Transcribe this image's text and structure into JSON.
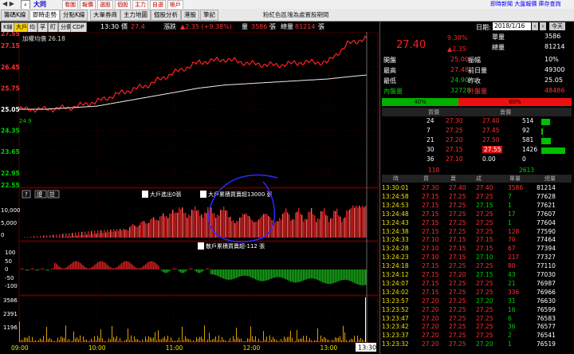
{
  "app": {
    "toolbar_buttons": [
      "看圖",
      "報價",
      "選股",
      "個股",
      "主力",
      "自選",
      "帳戶"
    ],
    "toolbar_right": [
      "即時新聞",
      "大盤報價",
      "庫存查詢"
    ]
  },
  "tabs": [
    "籌碼K線",
    "即時走勢",
    "分點K線",
    "大單券商",
    "主力地圖",
    "個股分析",
    "港股",
    "筆記"
  ],
  "active_tab": "即時走勢",
  "header": {
    "title_text": "粉紅色區塊為處置股期間",
    "search_icon": "search-icon",
    "stock_name": "大同"
  },
  "chart_toolbar": {
    "buttons": [
      "K線",
      "大戶",
      "均",
      "孚",
      "盯",
      "分價",
      "CDP"
    ],
    "selected": "大戶",
    "time": "13:30",
    "price_label": "價",
    "price": "27.4",
    "change_label": "漲跌",
    "change": "▲2.35 (+9.38%)",
    "vol_label": "量",
    "vol": "3586",
    "vol_unit": "張",
    "total_label": "總量",
    "total": "81214",
    "total_unit": "張"
  },
  "price_panel": {
    "legend": "加權均價 26.18",
    "y_ticks": [
      "27.55",
      "27.15",
      "26.45",
      "25.75",
      "25.05",
      "24.35",
      "23.65",
      "22.95",
      "22.55"
    ],
    "low_label": "24.9"
  },
  "big_panel": {
    "help": "?",
    "tabs": [
      "證",
      "註"
    ],
    "legend1": "大戶進出0張",
    "legend2": "大戶累積買賣超13000 張",
    "y_ticks": [
      "10,000",
      "5,000",
      "0"
    ]
  },
  "diff_panel": {
    "legend": "散戶累積買賣超-112 張",
    "y_ticks": [
      "100",
      "50",
      "0",
      "-50",
      "-100"
    ]
  },
  "vol_panel": {
    "y_ticks": [
      "3586",
      "2391",
      "1196"
    ]
  },
  "x_ticks": [
    "09:00",
    "10:00",
    "11:00",
    "12:00",
    "13:00"
  ],
  "cursor_time": "13:30",
  "chart_data": [
    {
      "type": "line",
      "title": "",
      "series": [
        {
          "name": "",
          "x": [
            "09:00",
            "09:20",
            "09:40",
            "10:00",
            "10:20",
            "10:40",
            "11:00",
            "11:20",
            "11:40",
            "12:00",
            "12:20",
            "12:40",
            "13:00",
            "13:15",
            "13:30"
          ],
          "values": [
            25.05,
            25.05,
            25.1,
            25.3,
            25.6,
            25.85,
            26.25,
            26.6,
            26.7,
            26.55,
            26.5,
            26.6,
            26.6,
            27.2,
            27.4
          ]
        },
        {
          "name": "",
          "values": [
            25.05,
            25.05,
            25.1,
            25.15,
            25.3,
            25.45,
            25.6,
            25.75,
            25.85,
            25.9,
            25.95,
            26.0,
            26.05,
            26.12,
            26.18
          ]
        }
      ],
      "ylim": [
        22.55,
        27.55
      ]
    },
    {
      "type": "bar",
      "title": "",
      "ylim": [
        0,
        13000
      ]
    },
    {
      "type": "bar",
      "title": "",
      "ylim": [
        -100,
        100
      ]
    },
    {
      "type": "bar",
      "title": "",
      "ylim": [
        0,
        3586
      ]
    }
  ],
  "quote": {
    "date_label": "日期:",
    "date": "2018/1/16",
    "prev_btn": "‹",
    "next_btn": "›",
    "today_btn": "今天",
    "price": "27.40",
    "pct": "9.38%",
    "chg": "▲2.35",
    "rows": [
      [
        "單量",
        "3586"
      ],
      [
        "總量",
        "81214"
      ],
      [
        "開盤",
        "25.00"
      ],
      [
        "振幅",
        "10%"
      ],
      [
        "最高",
        "27.48"
      ],
      [
        "前日量",
        "49300"
      ],
      [
        "最低",
        "24.90"
      ],
      [
        "昨收",
        "25.05"
      ],
      [
        "內盤量",
        "32728"
      ],
      [
        "外盤量",
        "48486"
      ]
    ],
    "inner_pct": "40%",
    "outer_pct": "60%"
  },
  "order_book": {
    "headers": [
      "買價",
      "賣價"
    ],
    "rows": [
      [
        "24",
        "27.30",
        "27.40",
        "514"
      ],
      [
        "7",
        "27.25",
        "27.45",
        "92"
      ],
      [
        "21",
        "27.20",
        "27.50",
        "581"
      ],
      [
        "30",
        "27.15",
        "27.55",
        "1426"
      ],
      [
        "36",
        "27.10",
        "0.00",
        "0"
      ]
    ],
    "bid_total": "118",
    "ask_total": "2613"
  },
  "ticks": {
    "headers": [
      "時",
      "買",
      "賣",
      "成",
      "單量",
      "總量"
    ],
    "rows": [
      [
        "13:30:01",
        "27.30",
        "27.40",
        "27.40",
        "3586",
        "81214"
      ],
      [
        "13:24:58",
        "27.15",
        "27.25",
        "27.25",
        "7",
        "77628"
      ],
      [
        "13:24:53",
        "27.15",
        "27.25",
        "27.15",
        "1",
        "77621"
      ],
      [
        "13:24:48",
        "27.15",
        "27.25",
        "27.25",
        "17",
        "77607"
      ],
      [
        "13:24:43",
        "27.15",
        "27.25",
        "27.25",
        "1",
        "77604"
      ],
      [
        "13:24:38",
        "27.15",
        "27.25",
        "27.25",
        "128",
        "77590"
      ],
      [
        "13:24:33",
        "27.10",
        "27.15",
        "27.15",
        "70",
        "77464"
      ],
      [
        "13:24:28",
        "27.10",
        "27.15",
        "27.15",
        "67",
        "77394"
      ],
      [
        "13:24:23",
        "27.10",
        "27.15",
        "27.10",
        "217",
        "77327"
      ],
      [
        "13:24:18",
        "27.15",
        "27.25",
        "27.25",
        "80",
        "77110"
      ],
      [
        "13:24:12",
        "27.15",
        "27.20",
        "27.15",
        "43",
        "77030"
      ],
      [
        "13:24:07",
        "27.15",
        "27.25",
        "27.25",
        "21",
        "76987"
      ],
      [
        "13:24:02",
        "27.15",
        "27.25",
        "27.25",
        "336",
        "76966"
      ],
      [
        "13:23:57",
        "27.20",
        "27.25",
        "27.20",
        "31",
        "76630"
      ],
      [
        "13:23:52",
        "27.20",
        "27.25",
        "27.25",
        "16",
        "76599"
      ],
      [
        "13:23:47",
        "27.20",
        "27.25",
        "27.25",
        "6",
        "76583"
      ],
      [
        "13:23:42",
        "27.20",
        "27.25",
        "27.25",
        "36",
        "76577"
      ],
      [
        "13:23:37",
        "27.20",
        "27.25",
        "27.25",
        "2",
        "76541"
      ],
      [
        "13:23:32",
        "27.20",
        "27.25",
        "27.20",
        "1",
        "76519"
      ]
    ]
  }
}
